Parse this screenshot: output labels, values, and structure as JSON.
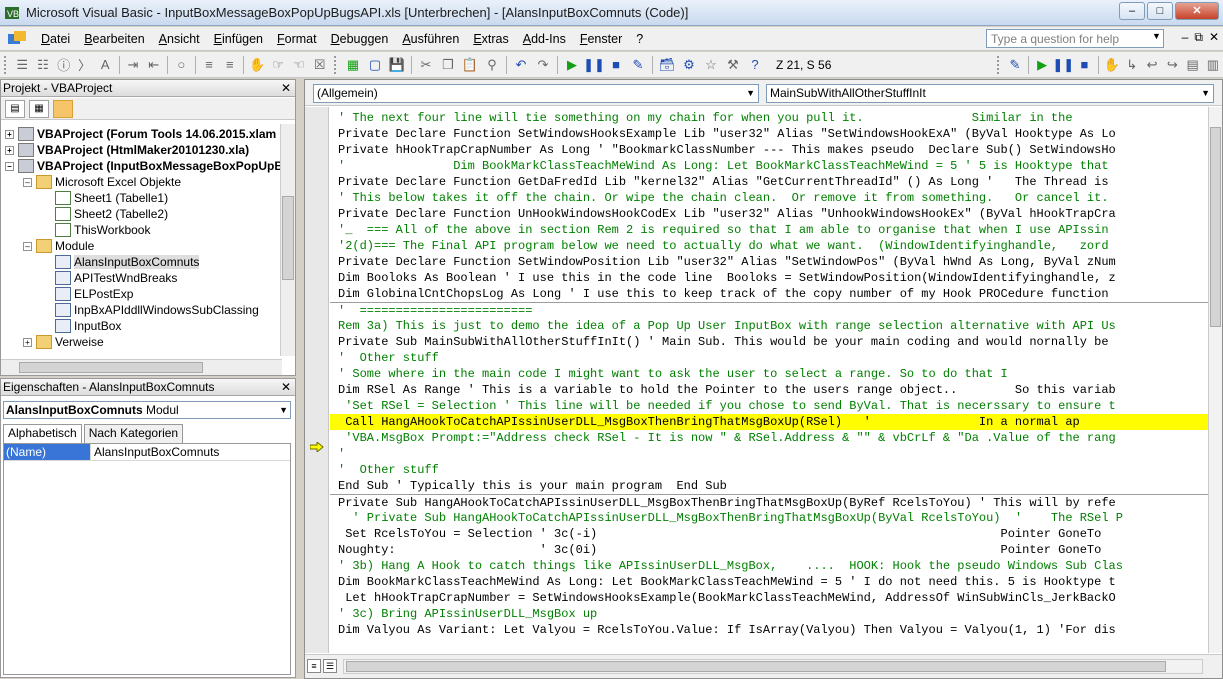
{
  "window": {
    "title": "Microsoft Visual Basic - InputBoxMessageBoxPopUpBugsAPI.xls [Unterbrechen] - [AlansInputBoxComnuts (Code)]"
  },
  "menu": {
    "items": [
      "Datei",
      "Bearbeiten",
      "Ansicht",
      "Einfügen",
      "Format",
      "Debuggen",
      "Ausführen",
      "Extras",
      "Add-Ins",
      "Fenster",
      "?"
    ],
    "help_placeholder": "Type a question for help"
  },
  "toolbar": {
    "cursor_position": "Z 21, S 56"
  },
  "project_panel": {
    "title": "Projekt - VBAProject",
    "tree": [
      {
        "label": "VBAProject (Forum Tools 14.06.2015.xlam",
        "bold": true
      },
      {
        "label": "VBAProject (HtmlMaker20101230.xla)",
        "bold": true
      },
      {
        "label": "VBAProject (InputBoxMessageBoxPopUpB",
        "bold": true
      },
      {
        "label": "Microsoft Excel Objekte"
      },
      {
        "label": "Sheet1 (Tabelle1)"
      },
      {
        "label": "Sheet2 (Tabelle2)"
      },
      {
        "label": "ThisWorkbook"
      },
      {
        "label": "Module"
      },
      {
        "label": "AlansInputBoxComnuts",
        "selected": true
      },
      {
        "label": "APITestWndBreaks"
      },
      {
        "label": "ELPostExp"
      },
      {
        "label": "InpBxAPIddllWindowsSubClassing"
      },
      {
        "label": "InputBox"
      },
      {
        "label": "Verweise"
      }
    ]
  },
  "properties_panel": {
    "title": "Eigenschaften - AlansInputBoxComnuts",
    "object_name": "AlansInputBoxComnuts",
    "object_type": "Modul",
    "tabs": [
      "Alphabetisch",
      "Nach Kategorien"
    ],
    "rows": [
      {
        "key": "(Name)",
        "value": "AlansInputBoxComnuts"
      }
    ]
  },
  "code_window": {
    "object_combo": "(Allgemein)",
    "procedure_combo": "MainSubWithAllOtherStuffInIt",
    "lines": [
      {
        "text": "' The next four line will tie something on my chain for when you pull it.               Similar in the",
        "type": "comment"
      },
      {
        "text": "Private Declare Function SetWindowsHooksExample Lib \"user32\" Alias \"SetWindowsHookExA\" (ByVal Hooktype As Lo",
        "type": "code"
      },
      {
        "text": "Private hHookTrapCrapNumber As Long ' \"BookmarkClassNumber --- This makes pseudo  Declare Sub() SetWindowsHo",
        "type": "code"
      },
      {
        "text": "'               Dim BookMarkClassTeachMeWind As Long: Let BookMarkClassTeachMeWind = 5 ' 5 is Hooktype that",
        "type": "comment"
      },
      {
        "text": "Private Declare Function GetDaFredId Lib \"kernel32\" Alias \"GetCurrentThreadId\" () As Long '   The Thread is",
        "type": "code"
      },
      {
        "text": "' This below takes it off the chain. Or wipe the chain clean.  Or remove it from something.   Or cancel it.",
        "type": "comment"
      },
      {
        "text": "Private Declare Function UnHookWindowsHookCodEx Lib \"user32\" Alias \"UnhookWindowsHookEx\" (ByVal hHookTrapCra",
        "type": "code"
      },
      {
        "text": "'_  === All of the above in section Rem 2 is required so that I am able to organise that when I use APIssin",
        "type": "comment"
      },
      {
        "text": "'2(d)=== The Final API program below we need to actually do what we want.  (WindowIdentifyinghandle,   zord",
        "type": "comment"
      },
      {
        "text": "Private Declare Function SetWindowPosition Lib \"user32\" Alias \"SetWindowPos\" (ByVal hWnd As Long, ByVal zNum",
        "type": "code"
      },
      {
        "text": "Dim Booloks As Boolean ' I use this in the code line  Booloks = SetWindowPosition(WindowIdentifyinghandle, z",
        "type": "code"
      },
      {
        "text": "Dim GlobinalCntChopsLog As Long ' I use this to keep track of the copy number of my Hook PROCedure function",
        "type": "code"
      },
      {
        "text": "'  ========================",
        "type": "comment",
        "separator": true
      },
      {
        "text": "Rem 3a) This is just to demo the idea of a Pop Up User InputBox with range selection alternative with API Us",
        "type": "comment"
      },
      {
        "text": "Private Sub MainSubWithAllOtherStuffInIt() ' Main Sub. This would be your main coding and would nornally be",
        "type": "code"
      },
      {
        "text": "'  Other stuff",
        "type": "comment"
      },
      {
        "text": "' Some where in the main code I might want to ask the user to select a range. So to do that I",
        "type": "comment"
      },
      {
        "text": "Dim RSel As Range ' This is a variable to hold the Pointer to the users range object..        So this variab",
        "type": "code"
      },
      {
        "text": " 'Set RSel = Selection ' This line will be needed if you chose to send ByVal. That is necerssary to ensure t",
        "type": "comment"
      },
      {
        "text": " Call HangAHookToCatchAPIssinUserDLL_MsgBoxThenBringThatMsgBoxUp(RSel)   '               In a normal ap",
        "type": "code",
        "highlight": true
      },
      {
        "text": " 'VBA.MsgBox Prompt:=\"Address check RSel - It is now \" & RSel.Address & \"\" & vbCrLf & \"Da .Value of the rang",
        "type": "comment"
      },
      {
        "text": "'",
        "type": "comment"
      },
      {
        "text": "'  Other stuff",
        "type": "comment"
      },
      {
        "text": "End Sub ' Typically this is your main program  End Sub",
        "type": "code"
      },
      {
        "text": "Private Sub HangAHookToCatchAPIssinUserDLL_MsgBoxThenBringThatMsgBoxUp(ByRef RcelsToYou) ' This will by refe",
        "type": "code",
        "separator": true
      },
      {
        "text": "  ' Private Sub HangAHookToCatchAPIssinUserDLL_MsgBoxThenBringThatMsgBoxUp(ByVal RcelsToYou)  '    The RSel P",
        "type": "comment"
      },
      {
        "text": " Set RcelsToYou = Selection ' 3c(-i)                                                        Pointer GoneTo",
        "type": "code"
      },
      {
        "text": "Noughty:                    ' 3c(0i)                                                        Pointer GoneTo",
        "type": "code"
      },
      {
        "text": "' 3b) Hang A Hook to catch things like APIssinUserDLL_MsgBox,    ....  HOOK: Hook the pseudo Windows Sub Clas",
        "type": "comment"
      },
      {
        "text": "Dim BookMarkClassTeachMeWind As Long: Let BookMarkClassTeachMeWind = 5 ' I do not need this. 5 is Hooktype t",
        "type": "code"
      },
      {
        "text": " Let hHookTrapCrapNumber = SetWindowsHooksExample(BookMarkClassTeachMeWind, AddressOf WinSubWinCls_JerkBackO",
        "type": "code"
      },
      {
        "text": "' 3c) Bring APIssinUserDLL_MsgBox up",
        "type": "comment"
      },
      {
        "text": "Dim Valyou As Variant: Let Valyou = RcelsToYou.Value: If IsArray(Valyou) Then Valyou = Valyou(1, 1) 'For dis",
        "type": "code"
      }
    ]
  }
}
